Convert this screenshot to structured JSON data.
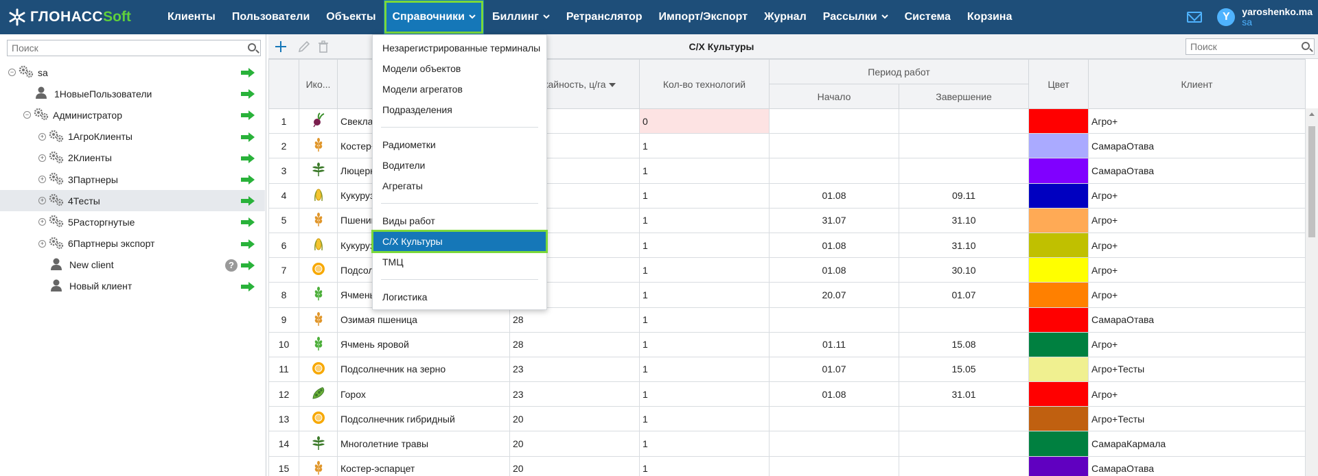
{
  "app": {
    "logo_a": "ГЛОНАСС",
    "logo_b": "Soft"
  },
  "nav": {
    "items": [
      {
        "label": "Клиенты",
        "dropdown": false
      },
      {
        "label": "Пользователи",
        "dropdown": false
      },
      {
        "label": "Объекты",
        "dropdown": false
      },
      {
        "label": "Справочники",
        "dropdown": true,
        "active": true
      },
      {
        "label": "Биллинг",
        "dropdown": true
      },
      {
        "label": "Ретранслятор",
        "dropdown": false
      },
      {
        "label": "Импорт/Экспорт",
        "dropdown": false
      },
      {
        "label": "Журнал",
        "dropdown": false
      },
      {
        "label": "Рассылки",
        "dropdown": true
      },
      {
        "label": "Система",
        "dropdown": false
      },
      {
        "label": "Корзина",
        "dropdown": false
      }
    ],
    "avatar_letter": "Y",
    "user_name": "yaroshenko.ma",
    "user_role": "sa"
  },
  "colors": {
    "nav_bg": "#1e4e79",
    "nav_active": "#1577b8",
    "highlight": "#7bd83a",
    "arrow_green": "#29b23a"
  },
  "left": {
    "search_placeholder": "Поиск",
    "tree": [
      {
        "label": "sa",
        "type": "group",
        "toggle": "⊖",
        "indent": 0
      },
      {
        "label": "1НовыеПользователи",
        "type": "user",
        "toggle": "",
        "indent": 1
      },
      {
        "label": "Администратор",
        "type": "group",
        "toggle": "⊖",
        "indent": 1
      },
      {
        "label": "1АгроКлиенты",
        "type": "group",
        "toggle": "⊕",
        "indent": 2
      },
      {
        "label": "2Клиенты",
        "type": "group",
        "toggle": "⊕",
        "indent": 2
      },
      {
        "label": "3Партнеры",
        "type": "group",
        "toggle": "⊕",
        "indent": 2
      },
      {
        "label": "4Тесты",
        "type": "group",
        "toggle": "⊕",
        "indent": 2,
        "selected": true
      },
      {
        "label": "5Расторгнутые",
        "type": "group",
        "toggle": "⊕",
        "indent": 2
      },
      {
        "label": "6Партнеры экспорт",
        "type": "group",
        "toggle": "⊕",
        "indent": 2
      },
      {
        "label": "New client",
        "type": "user",
        "toggle": "",
        "indent": 2,
        "help": true
      },
      {
        "label": "Новый клиент",
        "type": "user",
        "toggle": "",
        "indent": 2
      }
    ]
  },
  "main": {
    "title": "С/Х Культуры",
    "search_placeholder": "Поиск",
    "headers": {
      "icon": "Ико...",
      "name": "",
      "yield": "...жайность, ц/га",
      "tech": "Кол-во технологий",
      "period": "Период работ",
      "start": "Начало",
      "end": "Завершение",
      "color": "Цвет",
      "client": "Клиент"
    },
    "rows": [
      {
        "n": "1",
        "icon": "beet",
        "name": "Свекла",
        "yield": "",
        "tech": "0",
        "start": "",
        "end": "",
        "color": "#ff0000",
        "client": "Агро+",
        "neg": true
      },
      {
        "n": "2",
        "icon": "wheat",
        "name": "Костер+",
        "yield": "",
        "tech": "1",
        "start": "",
        "end": "",
        "color": "#aaaaff",
        "client": "СамараОтава"
      },
      {
        "n": "3",
        "icon": "herb",
        "name": "Люцерн",
        "yield": "",
        "tech": "1",
        "start": "",
        "end": "",
        "color": "#8000ff",
        "client": "СамараОтава"
      },
      {
        "n": "4",
        "icon": "corn",
        "name": "Кукуруз",
        "yield": "",
        "tech": "1",
        "start": "01.08",
        "end": "09.11",
        "color": "#0000c0",
        "client": "Агро+"
      },
      {
        "n": "5",
        "icon": "wheat",
        "name": "Пшениц",
        "yield": "",
        "tech": "1",
        "start": "31.07",
        "end": "31.10",
        "color": "#ffaa55",
        "client": "Агро+"
      },
      {
        "n": "6",
        "icon": "corn",
        "name": "Кукуруз",
        "yield": "",
        "tech": "1",
        "start": "01.08",
        "end": "31.10",
        "color": "#c0c000",
        "client": "Агро+"
      },
      {
        "n": "7",
        "icon": "sunflower",
        "name": "Подсолн",
        "yield": "",
        "tech": "1",
        "start": "01.08",
        "end": "30.10",
        "color": "#ffff00",
        "client": "Агро+"
      },
      {
        "n": "8",
        "icon": "barley",
        "name": "Ячмень",
        "yield": "",
        "tech": "1",
        "start": "20.07",
        "end": "01.07",
        "color": "#ff8000",
        "client": "Агро+"
      },
      {
        "n": "9",
        "icon": "wheat",
        "name": "Озимая пшеница",
        "yield": "28",
        "tech": "1",
        "start": "",
        "end": "",
        "color": "#ff0000",
        "client": "СамараОтава"
      },
      {
        "n": "10",
        "icon": "barley",
        "name": "Ячмень яровой",
        "yield": "28",
        "tech": "1",
        "start": "01.11",
        "end": "15.08",
        "color": "#008040",
        "client": "Агро+"
      },
      {
        "n": "11",
        "icon": "sunflower",
        "name": "Подсолнечник на зерно",
        "yield": "23",
        "tech": "1",
        "start": "01.07",
        "end": "15.05",
        "color": "#f0f090",
        "client": "Агро+Тесты"
      },
      {
        "n": "12",
        "icon": "peas",
        "name": "Горох",
        "yield": "23",
        "tech": "1",
        "start": "01.08",
        "end": "31.01",
        "color": "#ff0000",
        "client": "Агро+"
      },
      {
        "n": "13",
        "icon": "sunflower",
        "name": "Подсолнечник гибридный",
        "yield": "20",
        "tech": "1",
        "start": "",
        "end": "",
        "color": "#c06010",
        "client": "Агро+Тесты"
      },
      {
        "n": "14",
        "icon": "herb",
        "name": "Многолетние травы",
        "yield": "20",
        "tech": "1",
        "start": "",
        "end": "",
        "color": "#008040",
        "client": "СамараКармала"
      },
      {
        "n": "15",
        "icon": "wheat",
        "name": "Костер-эспарцет",
        "yield": "20",
        "tech": "1",
        "start": "",
        "end": "",
        "color": "#6000c0",
        "client": "СамараОтава"
      }
    ]
  },
  "dropdown": {
    "groups": [
      [
        "Незарегистрированные терминалы",
        "Модели объектов",
        "Модели агрегатов",
        "Подразделения"
      ],
      [
        "Радиометки",
        "Водители",
        "Агрегаты"
      ],
      [
        "Виды работ",
        "С/Х Культуры",
        "ТМЦ"
      ],
      [
        "Логистика"
      ]
    ],
    "active": "С/Х Культуры"
  }
}
